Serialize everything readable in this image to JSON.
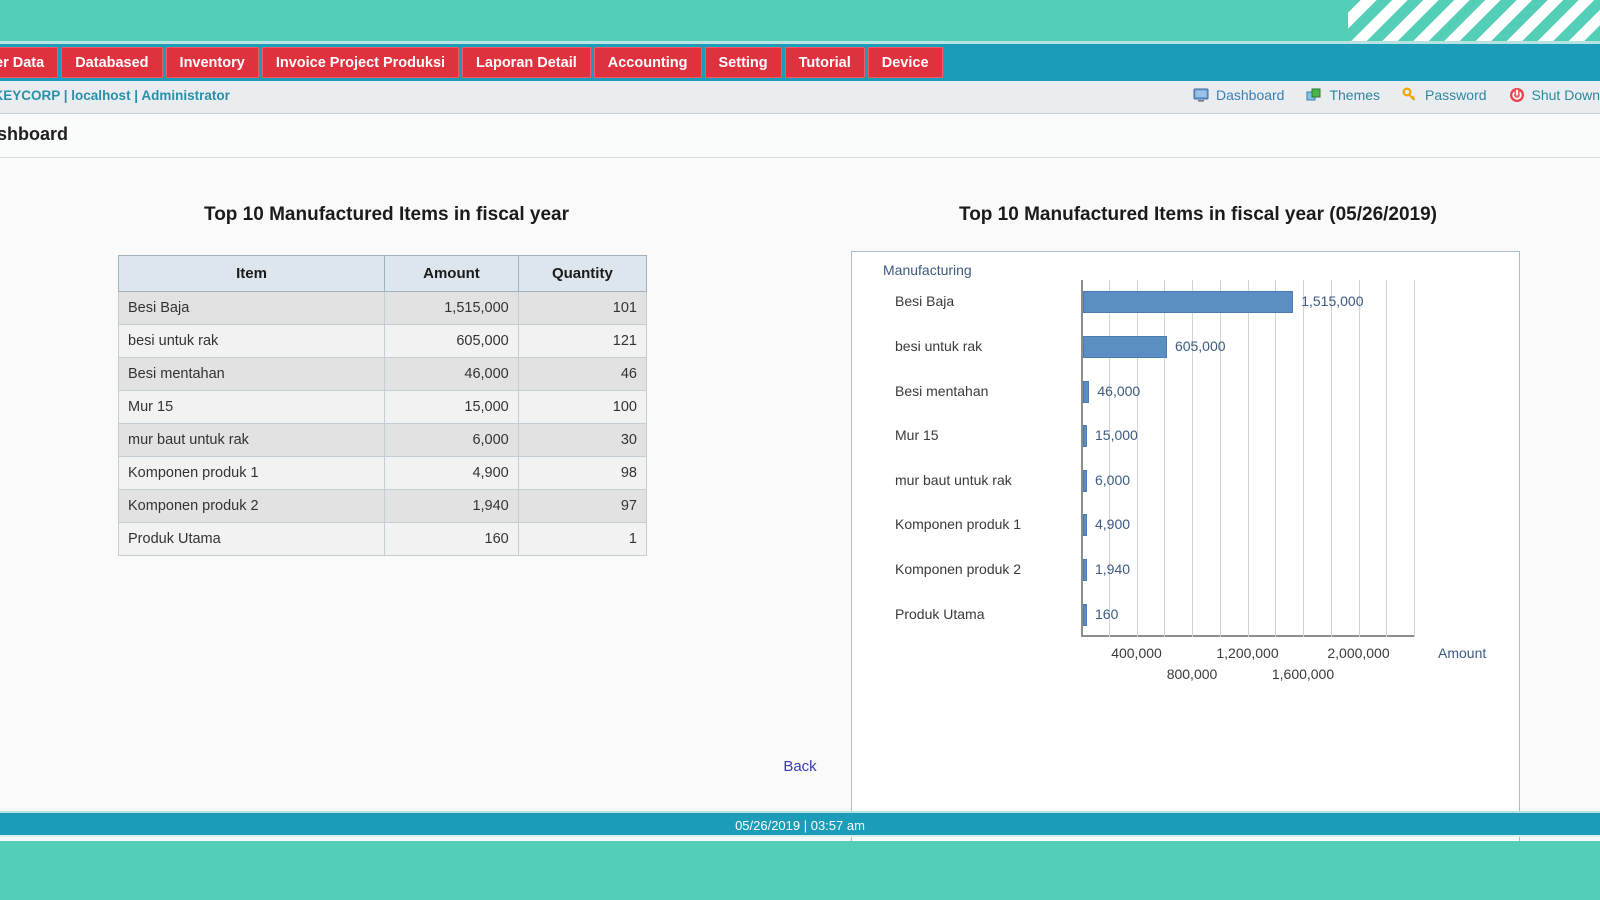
{
  "app": {
    "title": "Dashboard",
    "user_info": "...OCKEYCORP | localhost | Administrator"
  },
  "navbar": {
    "tabs": [
      {
        "label": "Master Data"
      },
      {
        "label": "Databased"
      },
      {
        "label": "Inventory"
      },
      {
        "label": "Invoice Project Produksi"
      },
      {
        "label": "Laporan Detail"
      },
      {
        "label": "Accounting"
      },
      {
        "label": "Setting"
      },
      {
        "label": "Tutorial"
      },
      {
        "label": "Device"
      }
    ]
  },
  "userbar": {
    "links": [
      {
        "label": "Dashboard",
        "icon": "monitor-icon"
      },
      {
        "label": "Themes",
        "icon": "themes-icon"
      },
      {
        "label": "Password",
        "icon": "key-icon"
      },
      {
        "label": "Shut Down",
        "icon": "power-icon"
      }
    ]
  },
  "left_panel": {
    "title": "Top 10 Manufactured Items in fiscal year",
    "table": {
      "columns": [
        "Item",
        "Amount",
        "Quantity"
      ],
      "rows": [
        [
          "Besi Baja",
          "1,515,000",
          "101"
        ],
        [
          "besi untuk rak",
          "605,000",
          "121"
        ],
        [
          "Besi mentahan",
          "46,000",
          "46"
        ],
        [
          "Mur 15",
          "15,000",
          "100"
        ],
        [
          "mur baut untuk rak",
          "6,000",
          "30"
        ],
        [
          "Komponen produk 1",
          "4,900",
          "98"
        ],
        [
          "Komponen produk 2",
          "1,940",
          "97"
        ],
        [
          "Produk Utama",
          "160",
          "1"
        ]
      ]
    }
  },
  "right_panel": {
    "title": "Top 10 Manufactured Items in fiscal year (05/26/2019)"
  },
  "chart_data": {
    "type": "bar",
    "orientation": "horizontal",
    "title": "Top 10 Manufactured Items in fiscal year (05/26/2019)",
    "legend": "Manufacturing",
    "legend_position": "top-left",
    "xlabel": "Amount",
    "ylabel": "",
    "grid": true,
    "xlim": [
      0,
      2400000
    ],
    "xticks": [
      400000,
      800000,
      1200000,
      1600000,
      2000000
    ],
    "xtick_labels": [
      "400,000",
      "800,000",
      "1,200,000",
      "1,600,000",
      "2,000,000"
    ],
    "categories": [
      "Besi Baja",
      "besi untuk rak",
      "Besi mentahan",
      "Mur 15",
      "mur baut untuk rak",
      "Komponen produk 1",
      "Komponen produk 2",
      "Produk Utama"
    ],
    "values": [
      1515000,
      605000,
      46000,
      15000,
      6000,
      4900,
      1940,
      160
    ],
    "data_labels": [
      "1,515,000",
      "605,000",
      "46,000",
      "15,000",
      "6,000",
      "4,900",
      "1,940",
      "160"
    ],
    "bar_color": "#5b8fc4"
  },
  "actions": {
    "back_label": "Back"
  },
  "footer": {
    "timestamp": "05/26/2019 | 03:57 am"
  },
  "colors": {
    "mint": "#52cfb6",
    "teal": "#1b9cb8",
    "tab_red": "#e0313f",
    "bar_blue": "#5b8fc4",
    "link_blue": "#3b7fb5"
  }
}
